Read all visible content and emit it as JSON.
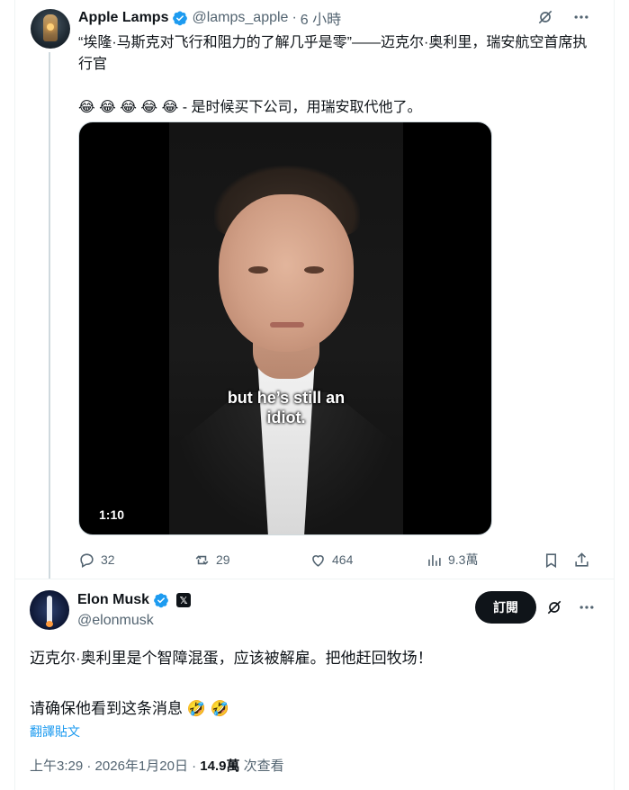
{
  "tweet": {
    "author_name": "Apple Lamps",
    "handle": "@lamps_apple",
    "time": "6 小時",
    "text": "“埃隆·马斯克对飞行和阻力的了解几乎是零”——迈克尔·奥利里，瑞安航空首席执行官\n\n😂 😂 😂 😂 😂 - 是时候买下公司，用瑞安取代他了。",
    "media": {
      "caption": "but he’s still an\nidiot.",
      "duration": "1:10"
    },
    "actions": {
      "replies": "32",
      "reposts": "29",
      "likes": "464",
      "views": "9.3萬"
    }
  },
  "reply": {
    "author_name": "Elon Musk",
    "handle": "@elonmusk",
    "subscribe_label": "訂閱",
    "text": "迈克尔·奥利里是个智障混蛋，应该被解雇。把他赶回牧场！\n\n请确保他看到这条消息 🤣 🤣",
    "translate_label": "翻譯貼文",
    "time": "上午3:29",
    "date": "2026年1月20日",
    "views_count": "14.9萬",
    "views_label": "次查看"
  },
  "colors": {
    "accent": "#1d9bf0",
    "secondary_text": "#536471",
    "primary_text": "#0f1419"
  }
}
